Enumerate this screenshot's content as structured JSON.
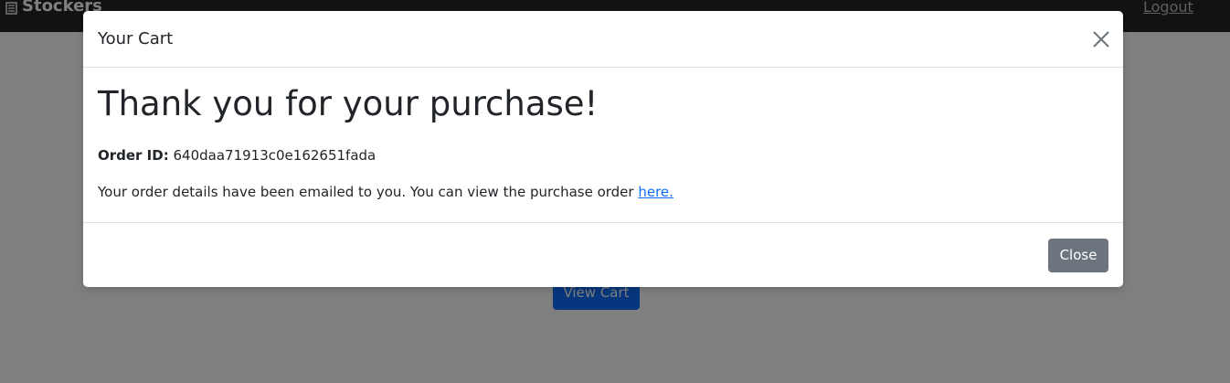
{
  "navbar": {
    "brand": "Stockers",
    "brand_icon": "document-icon",
    "logout_label": "Logout",
    "background": "#212529"
  },
  "page": {
    "view_cart_label": "View Cart",
    "view_cart_color": "#0d6efd"
  },
  "modal": {
    "title": "Your Cart",
    "close_icon": "close-icon",
    "heading": "Thank you for your purchase!",
    "order_id_label": "Order ID:",
    "order_id_value": "640daa71913c0e162651fada",
    "details_text": "Your order details have been emailed to you. You can view the purchase order ",
    "details_link": "here.",
    "close_button_label": "Close",
    "close_button_color": "#6c757d",
    "link_color": "#0d6efd"
  }
}
